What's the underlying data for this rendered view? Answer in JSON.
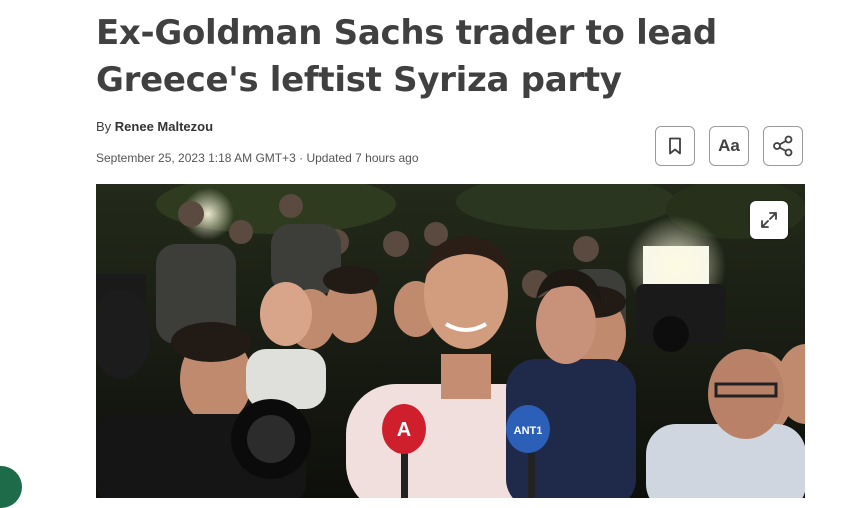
{
  "article": {
    "headline": "Ex-Goldman Sachs trader to lead Greece's leftist Syriza party",
    "byline_prefix": "By",
    "author": "Renee Maltezou",
    "dateline": "September 25, 2023 1:18 AM GMT+3 · Updated 7 hours ago"
  },
  "toolbar": {
    "bookmark_icon": "bookmark-icon",
    "text_size_label": "Aa",
    "share_icon": "share-icon"
  },
  "photo": {
    "expand_icon": "expand-icon",
    "mic_labels": [
      "A",
      "ANT1"
    ]
  },
  "colors": {
    "headline": "#404040",
    "button_border": "#9a9a9a",
    "fab": "#1e6b4a"
  }
}
